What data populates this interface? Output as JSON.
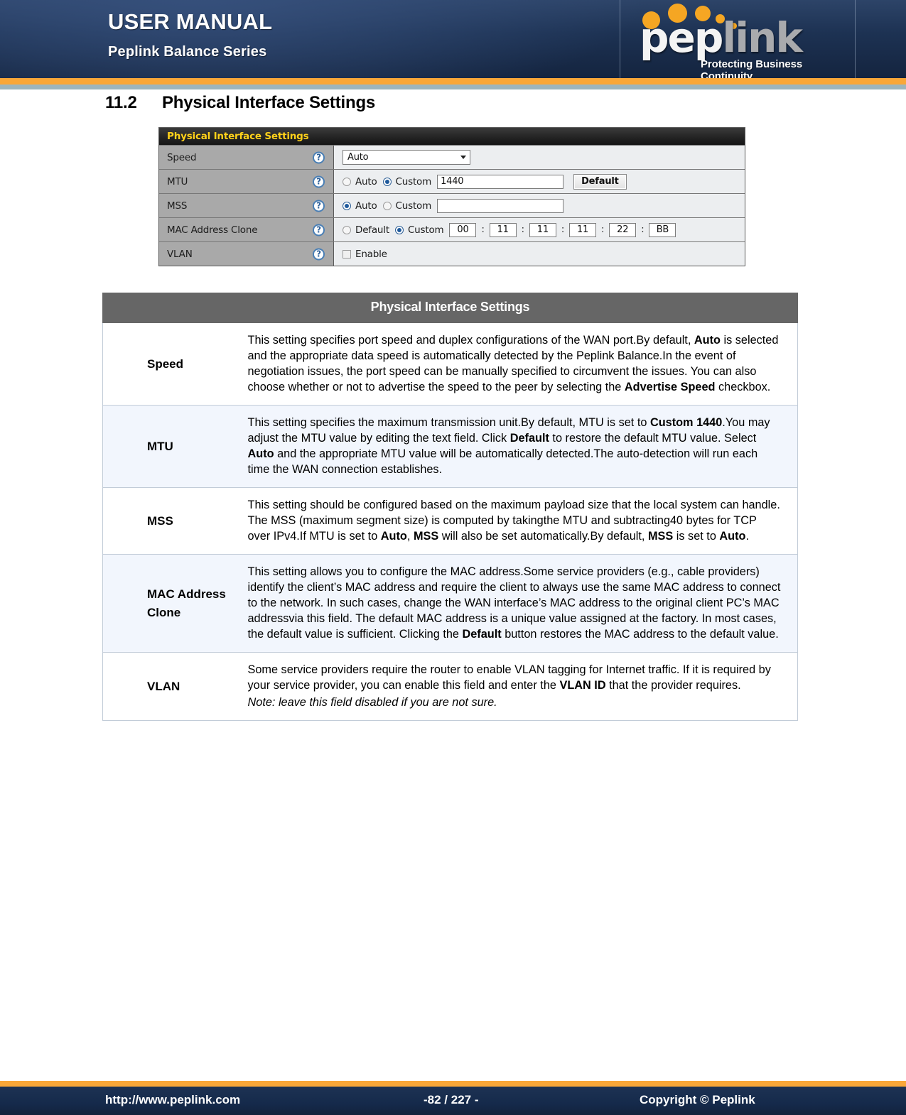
{
  "header": {
    "title": "USER MANUAL",
    "subtitle": "Peplink Balance Series",
    "logo_pep": "pep",
    "logo_link": "link",
    "logo_tagline": "Protecting Business Continuity"
  },
  "section": {
    "number": "11.2",
    "title": "Physical Interface Settings"
  },
  "screenshot": {
    "panel_title": "Physical Interface Settings",
    "rows": {
      "speed": {
        "label": "Speed",
        "help_icon": "?",
        "select_value": "Auto"
      },
      "mtu": {
        "label": "MTU",
        "help_icon": "?",
        "option_auto": "Auto",
        "option_custom": "Custom",
        "selected": "Custom",
        "custom_value": "1440",
        "default_button": "Default"
      },
      "mss": {
        "label": "MSS",
        "help_icon": "?",
        "option_auto": "Auto",
        "option_custom": "Custom",
        "selected": "Auto",
        "custom_value": ""
      },
      "mac_address_clone": {
        "label": "MAC Address Clone",
        "help_icon": "?",
        "option_default": "Default",
        "option_custom": "Custom",
        "selected": "Custom",
        "octets": [
          "00",
          "11",
          "11",
          "11",
          "22",
          "BB"
        ],
        "separator": ":"
      },
      "vlan": {
        "label": "VLAN",
        "help_icon": "?",
        "enable_label": "Enable",
        "enabled": false
      }
    }
  },
  "table": {
    "header": "Physical Interface Settings",
    "rows": [
      {
        "key": "Speed",
        "html": "This setting specifies port speed and duplex configurations of the WAN port.By default, <b>Auto</b> is selected and the appropriate data speed is automatically detected by the Peplink Balance.In the event of negotiation issues, the port speed can be manually specified to circumvent the issues. You can also choose whether or not to advertise the speed to the peer by selecting the <b>Advertise Speed</b> checkbox."
      },
      {
        "key": "MTU",
        "html": "This setting specifies the maximum transmission unit.By default, MTU is set to <b>Custom 1440</b>.You may adjust the MTU value by editing the text field. Click <b>Default</b> to restore the default MTU value. Select <b>Auto</b> and the appropriate MTU value will be automatically detected.The auto-detection will run each time the WAN connection establishes."
      },
      {
        "key": "MSS",
        "html": "This setting should be configured based on the maximum payload size that the local system can handle. The MSS (maximum segment size) is computed by takingthe MTU and subtracting40 bytes for TCP over IPv4.If MTU is set to <b>Auto</b>, <b>MSS</b> will also be set automatically.By default, <b>MSS</b> is set to <b>Auto</b>."
      },
      {
        "key": "MAC Address Clone",
        "html": "This setting allows you to configure the MAC address.Some service providers (e.g., cable providers) identify the client’s MAC address and require the client to always use the same MAC address to connect to the network. In such cases, change the WAN interface’s MAC address to the original client PC’s MAC addressvia this field. The default MAC address is a unique value assigned at the factory. In most cases, the default value is sufficient. Clicking the <b>Default</b> button restores the MAC address to the default value."
      },
      {
        "key": "VLAN",
        "html": "Some service providers require the router to enable VLAN tagging for Internet traffic. If it is required by your service provider, you can enable this field and enter the <b>VLAN ID</b> that the provider requires.<span class=\"note\">Note: leave this field disabled if you are not sure.</span>"
      }
    ]
  },
  "footer": {
    "url": "http://www.peplink.com",
    "page": "-82 / 227 -",
    "copyright": "Copyright ©  Peplink"
  },
  "colors": {
    "header_navy": "#15294a",
    "accent_orange": "#f9a738",
    "table_header_gray": "#666666",
    "row_alt_blue": "#f2f6fd",
    "panel_label_gray": "#a9a9a9",
    "panel_title_yellow": "#ffd11a"
  }
}
